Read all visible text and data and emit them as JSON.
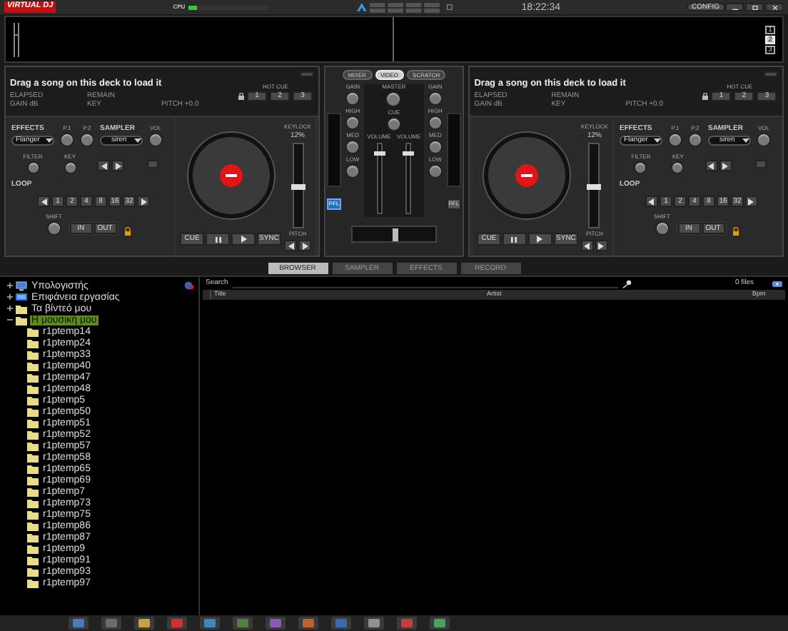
{
  "header": {
    "logo": "VIRTUAL DJ",
    "cpu": {
      "label": "CPU",
      "level": 0.12
    },
    "clock": "18:22:34",
    "config": "CONFIG"
  },
  "deck_selector": [
    {
      "label": "1",
      "selected": false
    },
    {
      "label": "2",
      "selected": true
    },
    {
      "label": "3",
      "selected": false
    }
  ],
  "decks": [
    {
      "kind": "left",
      "message": "Drag a song on this deck to load it",
      "elapsed": "ELAPSED",
      "remain": "REMAIN",
      "gain": "GAIN dB",
      "key": "KEY",
      "pitch": "PITCH +0.0",
      "hot_cue": "HOT CUE",
      "hot_cues": [
        "1",
        "2",
        "3"
      ],
      "effects": "EFFECTS",
      "effect": "Flanger",
      "p1": "P.1",
      "p2": "P.2",
      "sampler": "SAMPLER",
      "sample": "siren",
      "vol": "VOL",
      "filter": "FILTER",
      "key_knob": "KEY",
      "loop": "LOOP",
      "loop_buttons": [
        "1",
        "2",
        "4",
        "8",
        "16",
        "32"
      ],
      "shift": "SHIFT",
      "in": "IN",
      "out": "OUT",
      "transport": [
        {
          "kind": "text",
          "label": "CUE"
        },
        {
          "kind": "pause"
        },
        {
          "kind": "play"
        },
        {
          "kind": "text",
          "label": "SYNC"
        }
      ],
      "keylock": "KEYLOCK",
      "pitch_pct": "12%",
      "pitch_label": "PITCH",
      "pitch_slider": {
        "level": 0.5
      }
    },
    {
      "kind": "right",
      "message": "Drag a song on this deck to load it",
      "elapsed": "ELAPSED",
      "remain": "REMAIN",
      "gain": "GAIN dB",
      "key": "KEY",
      "pitch": "PITCH +0.0",
      "hot_cue": "HOT CUE",
      "hot_cues": [
        "1",
        "2",
        "3"
      ],
      "effects": "EFFECTS",
      "effect": "Flanger",
      "p1": "P.1",
      "p2": "P.2",
      "sampler": "SAMPLER",
      "sample": "siren",
      "vol": "VOL",
      "filter": "FILTER",
      "key_knob": "KEY",
      "loop": "LOOP",
      "loop_buttons": [
        "1",
        "2",
        "4",
        "8",
        "16",
        "32"
      ],
      "shift": "SHIFT",
      "in": "IN",
      "out": "OUT",
      "transport": [
        {
          "kind": "text",
          "label": "CUE"
        },
        {
          "kind": "pause"
        },
        {
          "kind": "play"
        },
        {
          "kind": "text",
          "label": "SYNC"
        }
      ],
      "keylock": "KEYLOCK",
      "pitch_pct": "12%",
      "pitch_label": "PITCH",
      "pitch_slider": {
        "level": 0.5
      }
    }
  ],
  "mixer": {
    "modes": [
      {
        "label": "MIXER",
        "selected": false
      },
      {
        "label": "VIDEO",
        "selected": true
      },
      {
        "label": "SCRATCH",
        "selected": false
      }
    ],
    "master": "MASTER",
    "cue": "CUE",
    "channels": [
      {
        "gain": "GAIN",
        "high": "HIGH",
        "med": "MED",
        "low": "LOW",
        "volume": "VOLUME",
        "fader": {
          "level": 0.9
        },
        "pfl": "PFL",
        "pfl_on": true
      },
      {
        "gain": "GAIN",
        "high": "HIGH",
        "med": "MED",
        "low": "LOW",
        "volume": "VOLUME",
        "fader": {
          "level": 0.9
        },
        "pfl": "PFL",
        "pfl_on": false
      }
    ],
    "crossfader": {
      "level": 0.5
    }
  },
  "browser_tabs": [
    {
      "label": "BROWSER",
      "selected": true
    },
    {
      "label": "SAMPLER",
      "selected": false
    },
    {
      "label": "EFFECTS",
      "selected": false
    },
    {
      "label": "RECORD",
      "selected": false
    }
  ],
  "tree": [
    {
      "label": "Υπολογιστής",
      "kind": "computer",
      "expanded": false,
      "selected": false
    },
    {
      "label": "Επιφάνεια εργασίας",
      "kind": "desktop",
      "expanded": false,
      "selected": false
    },
    {
      "label": "Τα βίντεό μου",
      "kind": "folder",
      "expanded": false,
      "selected": false
    },
    {
      "label": "Η μουσική μου",
      "kind": "folder",
      "expanded": true,
      "selected": true,
      "children": [
        {
          "label": "r1ptemp14",
          "kind": "folder",
          "selected": false
        },
        {
          "label": "r1ptemp24",
          "kind": "folder",
          "selected": false
        },
        {
          "label": "r1ptemp33",
          "kind": "folder",
          "selected": false
        },
        {
          "label": "r1ptemp40",
          "kind": "folder",
          "selected": false
        },
        {
          "label": "r1ptemp47",
          "kind": "folder",
          "selected": false
        },
        {
          "label": "r1ptemp48",
          "kind": "folder",
          "selected": false
        },
        {
          "label": "r1ptemp5",
          "kind": "folder",
          "selected": false
        },
        {
          "label": "r1ptemp50",
          "kind": "folder",
          "selected": false
        },
        {
          "label": "r1ptemp51",
          "kind": "folder",
          "selected": false
        },
        {
          "label": "r1ptemp52",
          "kind": "folder",
          "selected": false
        },
        {
          "label": "r1ptemp57",
          "kind": "folder",
          "selected": false
        },
        {
          "label": "r1ptemp58",
          "kind": "folder",
          "selected": false
        },
        {
          "label": "r1ptemp65",
          "kind": "folder",
          "selected": false
        },
        {
          "label": "r1ptemp69",
          "kind": "folder",
          "selected": false
        },
        {
          "label": "r1ptemp7",
          "kind": "folder",
          "selected": false
        },
        {
          "label": "r1ptemp73",
          "kind": "folder",
          "selected": false
        },
        {
          "label": "r1ptemp75",
          "kind": "folder",
          "selected": false
        },
        {
          "label": "r1ptemp86",
          "kind": "folder",
          "selected": false
        },
        {
          "label": "r1ptemp87",
          "kind": "folder",
          "selected": false
        },
        {
          "label": "r1ptemp9",
          "kind": "folder",
          "selected": false
        },
        {
          "label": "r1ptemp91",
          "kind": "folder",
          "selected": false
        },
        {
          "label": "r1ptemp93",
          "kind": "folder",
          "selected": false
        },
        {
          "label": "r1ptemp97",
          "kind": "folder",
          "selected": false
        }
      ]
    }
  ],
  "search": {
    "label": "Search",
    "files": "0 files"
  },
  "columns": [
    "Title",
    "Artist",
    "Bpm"
  ]
}
